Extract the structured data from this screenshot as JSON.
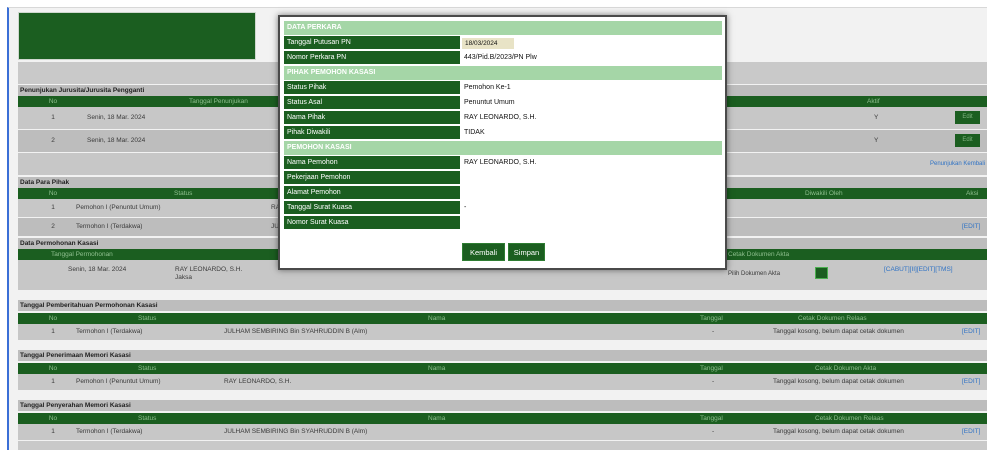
{
  "modal": {
    "sections": {
      "perkara": "DATA PERKARA",
      "pihak": "PIHAK PEMOHON KASASI",
      "pemohon": "PEMOHON KASASI"
    },
    "fields": {
      "tanggal_putusan_label": "Tanggal Putusan PN",
      "tanggal_putusan_value": "18/03/2024",
      "nomor_perkara_label": "Nomor Perkara PN",
      "nomor_perkara_value": "443/Pid.B/2023/PN Plw",
      "status_pihak_label": "Status Pihak",
      "status_pihak_value": "Pemohon Ke-1",
      "status_asal_label": "Status Asal",
      "status_asal_value": "Penuntut Umum",
      "nama_pihak_label": "Nama Pihak",
      "nama_pihak_value": "RAY LEONARDO, S.H.",
      "pihak_diwakili_label": "Pihak Diwakili",
      "pihak_diwakili_value": "TIDAK",
      "nama_pemohon_label": "Nama Pemohon",
      "nama_pemohon_value": "RAY LEONARDO, S.H.",
      "pekerjaan_label": "Pekerjaan Pemohon",
      "alamat_label": "Alamat Pemohon",
      "tanggal_kuasa_label": "Tanggal Surat Kuasa",
      "tanggal_kuasa_value": "-",
      "nomor_kuasa_label": "Nomor Surat Kuasa"
    },
    "buttons": {
      "kembali": "Kembali",
      "simpan": "Simpan"
    }
  },
  "penunjukan": {
    "title": "Penunjukan Jurusita/Jurusita Pengganti",
    "headers": {
      "no": "No",
      "tanggal": "Tanggal Penunjukan",
      "aktif": "Aktif"
    },
    "rows": [
      {
        "no": "1",
        "tanggal": "Senin, 18 Mar. 2024",
        "aktif": "Y",
        "edit": "Edit"
      },
      {
        "no": "2",
        "tanggal": "Senin, 18 Mar. 2024",
        "aktif": "Y",
        "edit": "Edit"
      }
    ],
    "link": "Penunjukan Kembali"
  },
  "para_pihak": {
    "title": "Data Para Pihak",
    "headers": {
      "no": "No",
      "status": "Status",
      "diwakili": "Diwakili Oleh",
      "aksi": "Aksi"
    },
    "rows": [
      {
        "no": "1",
        "status": "Pemohon I (Penuntut Umum)",
        "nama": "RAY"
      },
      {
        "no": "2",
        "status": "Termohon I (Terdakwa)",
        "nama": "JULI",
        "aksi": "[EDIT]"
      }
    ]
  },
  "permohonan": {
    "title": "Data Permohonan Kasasi",
    "headers": {
      "tanggal": "Tanggal Permohonan",
      "cetak": "Cetak Dokumen Akta"
    },
    "row": {
      "tanggal": "Senin, 18 Mar. 2024",
      "nama": "RAY LEONARDO, S.H.",
      "nama_sub": "Jaksa",
      "dash": "-",
      "select_label": "Pilih Dokumen Akta",
      "actions": "[CABUT][II][EDIT][TMS]"
    }
  },
  "pemberitahuan": {
    "title": "Tanggal Pemberitahuan Permohonan Kasasi",
    "headers": {
      "no": "No",
      "status": "Status",
      "nama": "Nama",
      "tanggal": "Tanggal",
      "cetak": "Cetak Dokumen Relaas"
    },
    "row": {
      "no": "1",
      "status": "Termohon I (Terdakwa)",
      "nama": "JULHAM SEMBIRING Bin SYAHRUDDIN B (Alm)",
      "tanggal": "-",
      "cetak": "Tanggal kosong, belum dapat cetak dokumen",
      "aksi": "[EDIT]"
    }
  },
  "penerimaan": {
    "title": "Tanggal Penerimaan Memori Kasasi",
    "headers": {
      "no": "No",
      "status": "Status",
      "nama": "Nama",
      "tanggal": "Tanggal",
      "cetak": "Cetak Dokumen Akta"
    },
    "row": {
      "no": "1",
      "status": "Pemohon I (Penuntut Umum)",
      "nama": "RAY LEONARDO, S.H.",
      "tanggal": "-",
      "cetak": "Tanggal kosong, belum dapat cetak dokumen",
      "aksi": "[EDIT]"
    }
  },
  "penyerahan": {
    "title": "Tanggal Penyerahan Memori Kasasi",
    "headers": {
      "no": "No",
      "status": "Status",
      "nama": "Nama",
      "tanggal": "Tanggal",
      "cetak": "Cetak Dokumen Relaas"
    },
    "row": {
      "no": "1",
      "status": "Termohon I (Terdakwa)",
      "nama": "JULHAM SEMBIRING Bin SYAHRUDDIN B (Alm)",
      "tanggal": "-",
      "cetak": "Tanggal kosong, belum dapat cetak dokumen",
      "aksi": "[EDIT]"
    }
  }
}
